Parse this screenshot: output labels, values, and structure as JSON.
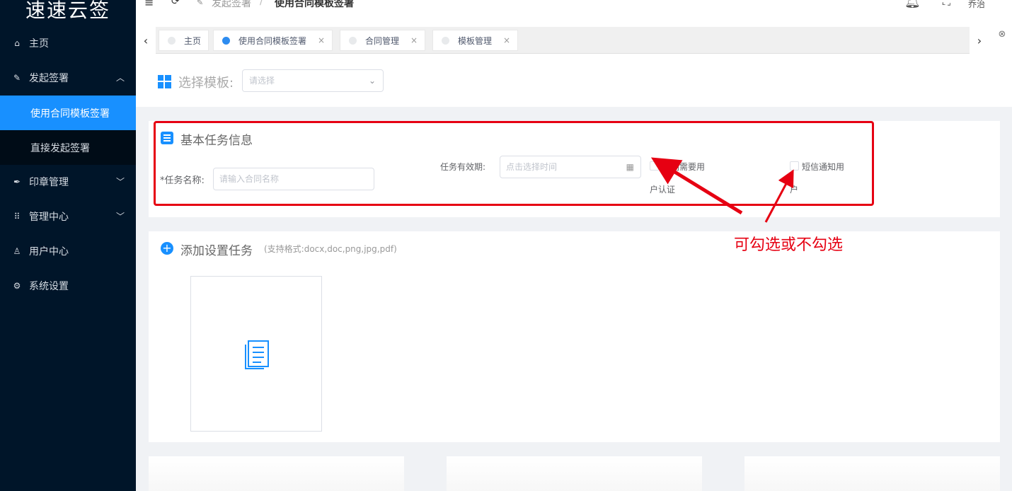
{
  "app": {
    "logo": "速速云签"
  },
  "sidebar": {
    "items": [
      {
        "label": "主页",
        "icon": "home-icon"
      },
      {
        "label": "发起签署",
        "icon": "edit-icon"
      },
      {
        "label": "使用合同模板签署"
      },
      {
        "label": "直接发起签署"
      },
      {
        "label": "印章管理",
        "icon": "pen-icon"
      },
      {
        "label": "管理中心",
        "icon": "grid-icon"
      },
      {
        "label": "用户中心",
        "icon": "user-icon"
      },
      {
        "label": "系统设置",
        "icon": "gear-icon"
      }
    ]
  },
  "header": {
    "breadcrumb": [
      "发起签署",
      "使用合同模板签署"
    ],
    "separator": "/",
    "user": "乔治"
  },
  "tabs": [
    {
      "label": "主页",
      "active": false,
      "closable": false
    },
    {
      "label": "使用合同模板签署",
      "active": true,
      "closable": true
    },
    {
      "label": "合同管理",
      "active": false,
      "closable": true
    },
    {
      "label": "模板管理",
      "active": false,
      "closable": true
    }
  ],
  "template_select": {
    "label": "选择模板:",
    "placeholder": "请选择"
  },
  "task_info": {
    "title": "基本任务信息",
    "name_label": "*任务名称:",
    "name_placeholder": "请输入合同名称",
    "validity_label": "任务有效期:",
    "validity_placeholder": "点击选择时间",
    "check1_label_a": "合同需要用",
    "check1_label_b": "户认证",
    "check2_label_a": "短信通知用",
    "check2_label_b": "户"
  },
  "annotation": {
    "text": "可勾选或不勾选",
    "color": "#e60012"
  },
  "add_task": {
    "title": "添加设置任务",
    "hint": "(支持格式:docx,doc,png,jpg,pdf)"
  },
  "colors": {
    "accent": "#1890ff",
    "sidebar_bg": "#001529"
  }
}
